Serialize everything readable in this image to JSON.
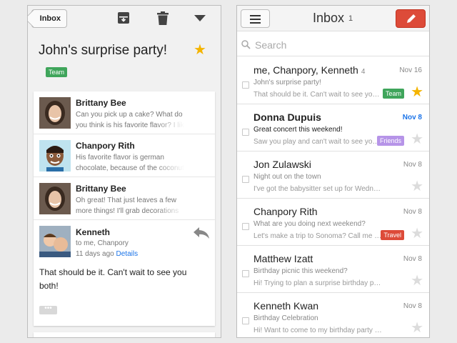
{
  "left": {
    "back_label": "Inbox",
    "subject": "John's surprise party!",
    "label": {
      "text": "Team",
      "color": "#3fa55b"
    },
    "messages": [
      {
        "sender": "Brittany Bee",
        "snippet": "Can you pick up a cake? What do you think is his favorite flavor? I lik"
      },
      {
        "sender": "Chanpory Rith",
        "snippet": "His favorite flavor is german chocolate, because of the coconut"
      },
      {
        "sender": "Brittany Bee",
        "snippet": "Oh great! That just leaves a few more things! I'll grab decorations"
      }
    ],
    "expanded": {
      "sender": "Kenneth",
      "to": "to me, Chanpory",
      "time": "11 days ago",
      "details": "Details",
      "body": "That should be it. Can't wait to see you both!",
      "more": "•••"
    }
  },
  "right": {
    "title": "Inbox",
    "count": "1",
    "search_placeholder": "Search",
    "threads": [
      {
        "sender": "me, Chanpory, Kenneth",
        "count": "4",
        "date": "Nov 16",
        "subject": "John's surprise party!",
        "snippet": "That should be it. Can't wait to see you both!",
        "label": "Team",
        "label_color": "#3fa55b",
        "starred": true,
        "unread": false
      },
      {
        "sender": "Donna Dupuis",
        "count": "",
        "date": "Nov 8",
        "subject": "Great concert this weekend!",
        "snippet": "Saw you play and can't wait to see you play again",
        "label": "Friends",
        "label_color": "#b694e8",
        "starred": false,
        "unread": true
      },
      {
        "sender": "Jon Zulawski",
        "count": "",
        "date": "Nov 8",
        "subject": "Night out on the town",
        "snippet": "I've got the babysitter set up for Wednesday night",
        "label": "",
        "label_color": "",
        "starred": false,
        "unread": false
      },
      {
        "sender": "Chanpory Rith",
        "count": "",
        "date": "Nov 8",
        "subject": "What are you doing next weekend?",
        "snippet": "Let's make a trip to Sonoma? Call me when you get this",
        "label": "Travel",
        "label_color": "#dd4b39",
        "starred": false,
        "unread": false
      },
      {
        "sender": "Matthew Izatt",
        "count": "",
        "date": "Nov 8",
        "subject": "Birthday picnic this weekend?",
        "snippet": "Hi! Trying to plan a surprise birthday picnic for John",
        "label": "",
        "label_color": "",
        "starred": false,
        "unread": false
      },
      {
        "sender": "Kenneth Kwan",
        "count": "",
        "date": "Nov 8",
        "subject": "Birthday Celebration",
        "snippet": "Hi! Want to come to my birthday party this weekend?",
        "label": "",
        "label_color": "",
        "starred": false,
        "unread": false
      }
    ]
  },
  "colors": {
    "accent": "#dd4b39",
    "star": "#f4b400",
    "unread_date": "#1a73e8"
  }
}
